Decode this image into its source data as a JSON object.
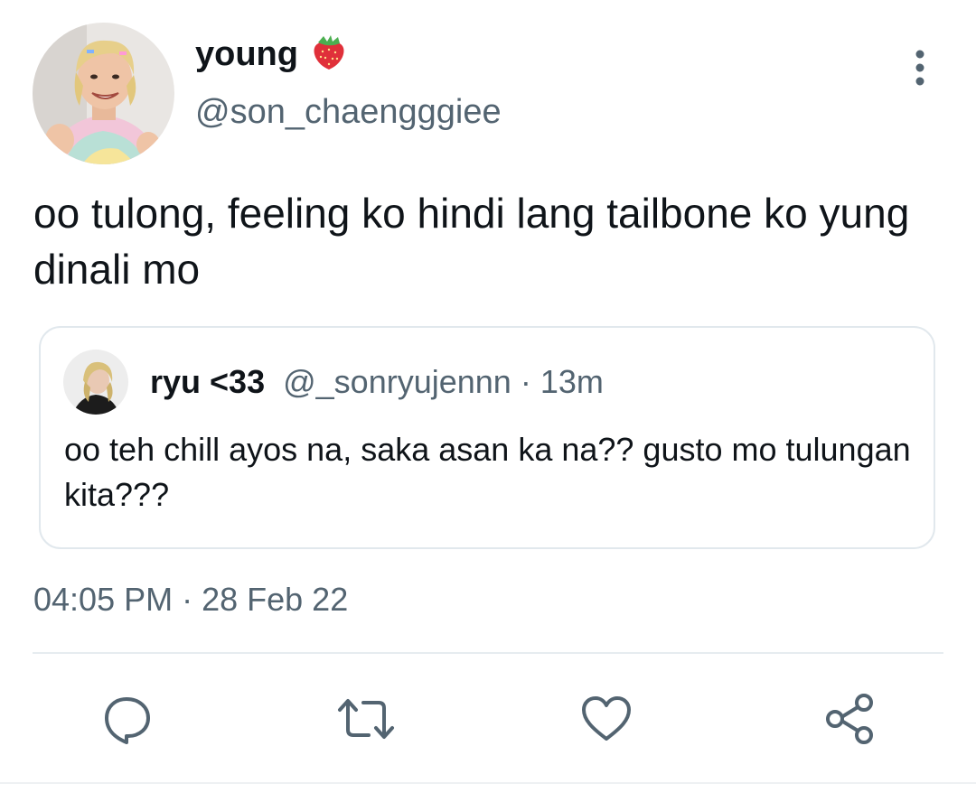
{
  "tweet": {
    "display_name": "young",
    "handle": "@son_chaengggiee",
    "text": "oo tulong, feeling ko hindi lang tailbone ko yung dinali mo",
    "timestamp": "04:05 PM",
    "date": "28 Feb 22",
    "separator": " · "
  },
  "quoted_tweet": {
    "display_name": "ryu <33",
    "handle": "@_sonryujennn",
    "separator": " · ",
    "time_ago": "13m",
    "text": "oo teh chill ayos na, saka asan ka na?? gusto mo tulungan kita???"
  },
  "actions": [
    {
      "name": "reply",
      "icon": "speech-bubble-icon"
    },
    {
      "name": "retweet",
      "icon": "retweet-arrows-icon"
    },
    {
      "name": "like",
      "icon": "heart-icon"
    },
    {
      "name": "share",
      "icon": "share-nodes-icon"
    }
  ],
  "colors": {
    "primary_text": "#0f1419",
    "secondary_text": "#536471",
    "border": "#e1e8ed",
    "icon": "#536471",
    "strawberry": "#e0303a"
  }
}
